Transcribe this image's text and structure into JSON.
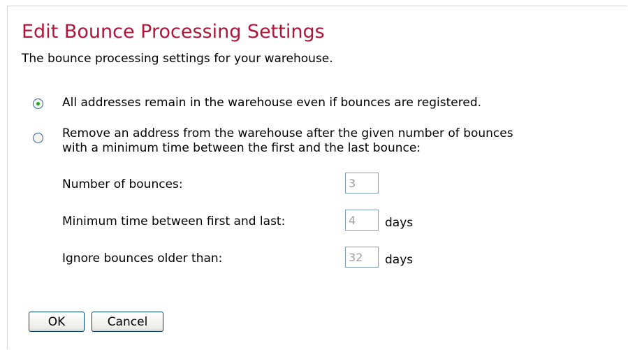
{
  "page": {
    "title": "Edit Bounce Processing Settings",
    "subtitle": "The bounce processing settings for your warehouse."
  },
  "options": [
    {
      "label": "All addresses remain in the warehouse even if bounces are registered.",
      "checked": true
    },
    {
      "label_line1": "Remove an address from the warehouse after the given number of bounces",
      "label_line2": "with a minimum time between the first and the last bounce:",
      "checked": false
    }
  ],
  "fields": [
    {
      "label": "Number of bounces:",
      "value": "3",
      "unit": ""
    },
    {
      "label": "Minimum time between first and last:",
      "value": "4",
      "unit": "days"
    },
    {
      "label": "Ignore bounces older than:",
      "value": "32",
      "unit": "days"
    }
  ],
  "buttons": {
    "ok_label": "OK",
    "cancel_label": "Cancel"
  },
  "colors": {
    "title": "#b0163a",
    "radio_checked_dot": "#25a325",
    "disabled_text": "#a0a0a0"
  }
}
